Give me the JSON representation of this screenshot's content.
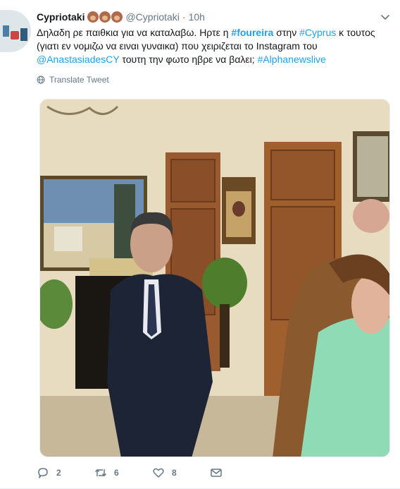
{
  "tweet": {
    "user": {
      "name": "Cypriotaki",
      "handle": "@Cypriotaki"
    },
    "separator": "·",
    "time": "10h",
    "text": {
      "t1": "Δηλαδη ρε παιθκια για να καταλαβω. Ηρτε η ",
      "hashtag1": "#foureira",
      "t2": " στην ",
      "hashtag2": "#Cyprus",
      "t3": " κ τουτος (γιατι εν νομιζω να ειναι γυναικα) που χειριζεται το Instagram του ",
      "mention": "@AnastasiadesCY",
      "t4": " τουτη την φωτο ηβρε να βαλει; ",
      "hashtag3": "#Alphanewslive"
    },
    "translate_label": "Translate Tweet",
    "actions": {
      "reply_count": "2",
      "retweet_count": "6",
      "like_count": "8"
    },
    "icons": {
      "reply": "speech-bubble-icon",
      "retweet": "retweet-arrows-icon",
      "like": "heart-icon",
      "dm": "envelope-icon",
      "translate": "globe-icon",
      "more": "chevron-down-icon",
      "emoji": "see-no-evil-monkey-icon"
    },
    "colors": {
      "link": "#1da1f2",
      "secondary_text": "#657786",
      "primary_text": "#14171a"
    }
  }
}
